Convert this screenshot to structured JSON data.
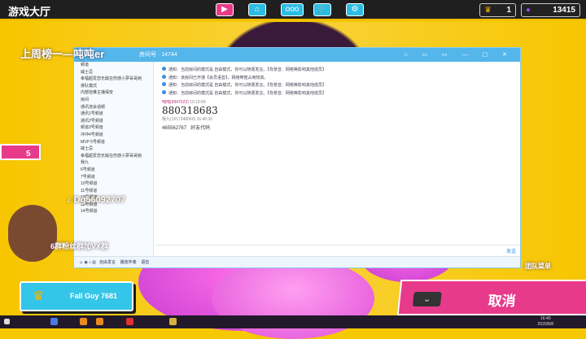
{
  "topbar": {
    "title": "游戏大厅",
    "nav": [
      {
        "icon": "play-icon",
        "active": true
      },
      {
        "icon": "hanger-icon"
      },
      {
        "icon": "party-icon"
      },
      {
        "icon": "cart-icon"
      },
      {
        "icon": "gear-icon"
      }
    ],
    "crowns": "1",
    "kudos": "13415"
  },
  "overlay": {
    "weekly_top": "上周榜一",
    "streamer": "吨吨er",
    "level": "5",
    "tiktok_id": "Dg56092707",
    "fan_group": "6群粉丝群加VX群",
    "team_menu": "团队菜单"
  },
  "chat": {
    "title_text": "房间号 · 14744",
    "left_items": [
      "频道",
      "威士忌",
      "幸福超爱您无敌在伤感小夢哥哥她",
      "排队模式",
      "内部自推主播保安",
      "房间",
      "通讯流会话频",
      "通讯1号频道",
      "通讯2号频道",
      "频道3号频道",
      "冲冲4号频道",
      "MVP 5号频道",
      "威士忌",
      "幸福超爱您无敌在伤感小夢哥哥她",
      "我九",
      "6号频道",
      "7号频道",
      "10号频道",
      "11号频道",
      "12号频道",
      "13号频道",
      "14号频道"
    ],
    "notices": [
      "通知：当前房间的模式是 自由模式，你可以随便发言。【背景音、网络等影响其他成员】",
      "通知：该房间已开通【会员语音】，网络带宽占用较高。",
      "通知：当前房间的模式是 自由模式，你可以随便发言。【背景音、网络等影响其他成员】",
      "通知：当前房间的模式是 自由模式，你可以随便发言。【背景音、网络等影响其他成员】"
    ],
    "msg1": {
      "user": "吨吨(9947022)",
      "time": "15:19:09",
      "text": "880318683"
    },
    "msg2": {
      "user": "我九(1617348060)",
      "time": "16:40:30",
      "text": "465562767",
      "note": "好友代码"
    },
    "bottom_items": [
      "自由发言",
      "播放伴奏",
      "语音"
    ],
    "send_label": "发送"
  },
  "player": {
    "name": "Fall Guy 7681"
  },
  "cancel": {
    "label": "取消",
    "key": "⎵"
  },
  "taskbar": {
    "time": "16:40",
    "date": "2020/8/8"
  }
}
